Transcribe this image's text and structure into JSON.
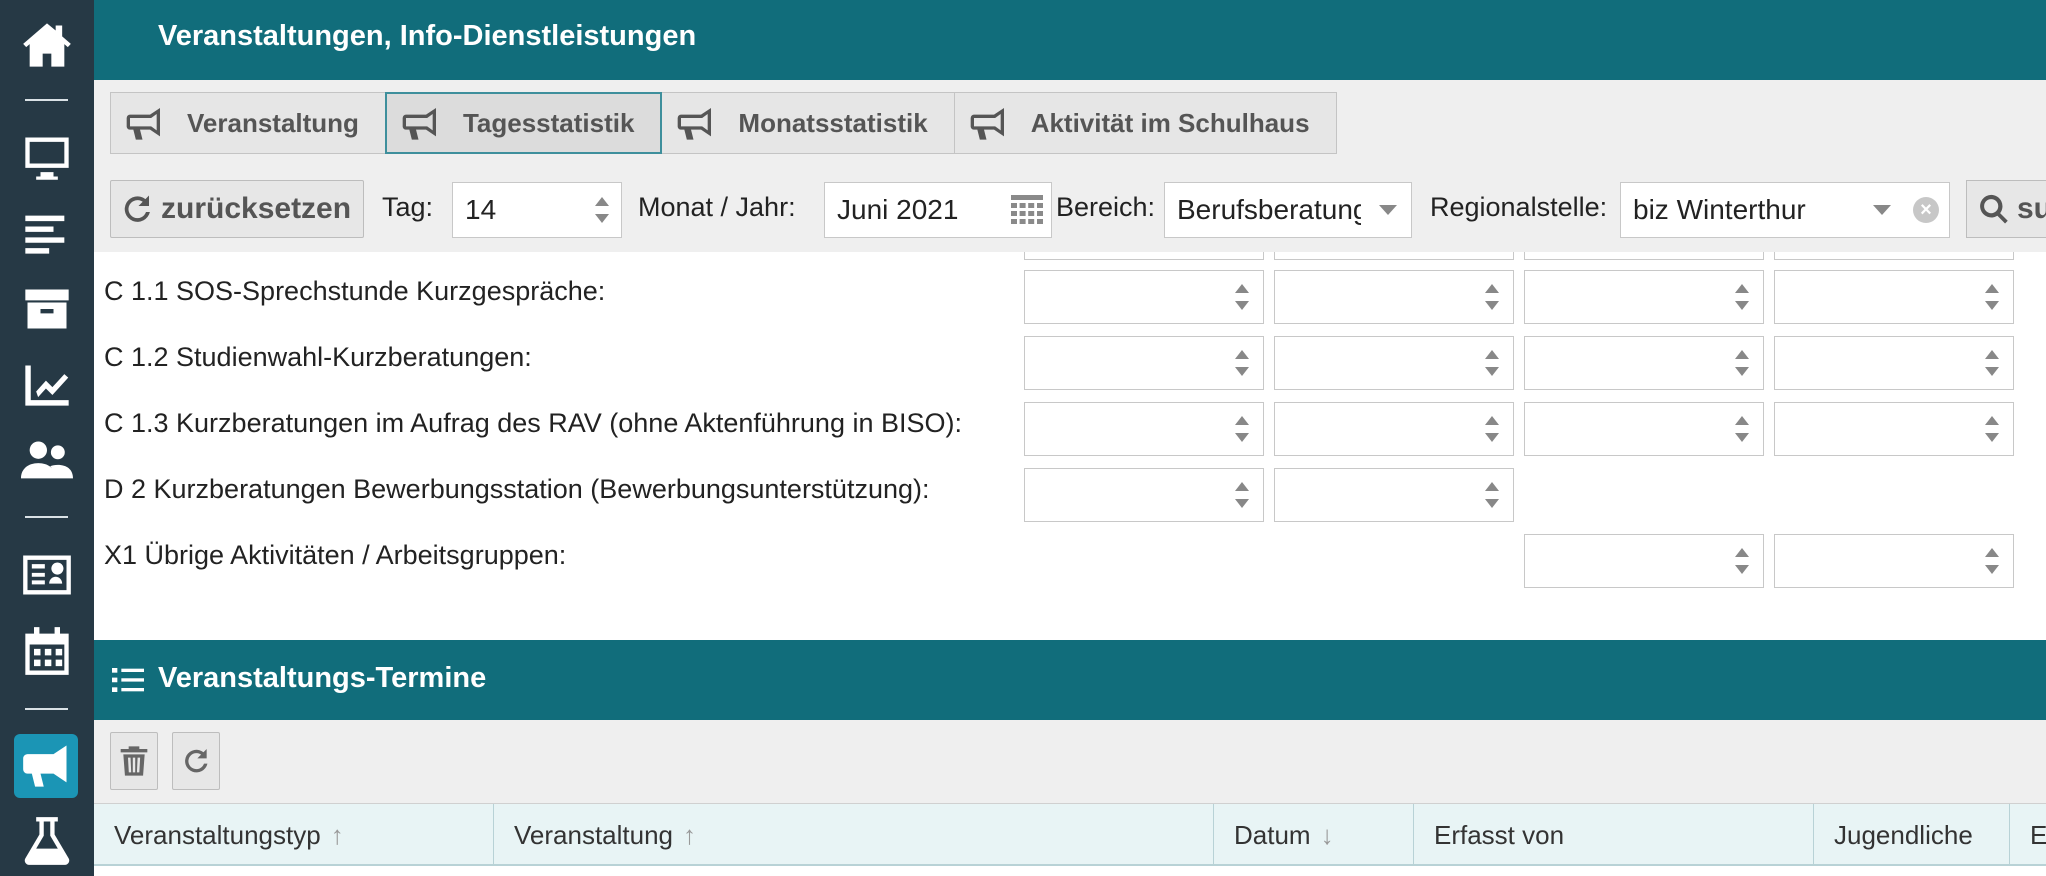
{
  "app": {
    "title": "Veranstaltungen, Info-Dienstleistungen"
  },
  "sidebar": {
    "items": [
      {
        "icon": "home-icon"
      },
      {
        "icon": "desktop-icon"
      },
      {
        "icon": "align-left-icon"
      },
      {
        "icon": "archive-icon"
      },
      {
        "icon": "chart-line-icon"
      },
      {
        "icon": "users-icon"
      },
      {
        "icon": "id-card-icon"
      },
      {
        "icon": "calendar-icon"
      },
      {
        "icon": "megaphone-icon",
        "active": true
      },
      {
        "icon": "flask-icon"
      }
    ],
    "active_color": "#1b95b5"
  },
  "tabs": [
    {
      "label": "Veranstaltung",
      "icon": "megaphone-icon"
    },
    {
      "label": "Tagesstatistik",
      "icon": "megaphone-icon",
      "active": true
    },
    {
      "label": "Monatsstatistik",
      "icon": "megaphone-icon"
    },
    {
      "label": "Aktivität im Schulhaus",
      "icon": "megaphone-icon"
    }
  ],
  "filters": {
    "reset_label": "zurücksetzen",
    "day_label": "Tag:",
    "day_value": "14",
    "month_label": "Monat / Jahr:",
    "month_value": "Juni 2021",
    "area_label": "Bereich:",
    "area_value": "Berufsberatung",
    "region_label": "Regionalstelle:",
    "region_value": "biz Winterthur",
    "search_label": "suchen"
  },
  "form_rows": [
    {
      "label": "C 1.1 SOS-Sprechstunde Kurzgespräche:"
    },
    {
      "label": "C 1.2 Studienwahl-Kurzberatungen:"
    },
    {
      "label": "C 1.3 Kurzberatungen im Aufrag des RAV (ohne Aktenführung in BISO):"
    },
    {
      "label": "D 2 Kurzberatungen Bewerbungsstation (Bewerbungsunterstützung):"
    },
    {
      "label": "X1 Übrige Aktivitäten / Arbeitsgruppen:"
    }
  ],
  "section": {
    "title": "Veranstaltungs-Termine"
  },
  "table": {
    "columns": [
      {
        "label": "Veranstaltungstyp",
        "sort": "↑"
      },
      {
        "label": "Veranstaltung",
        "sort": "↑"
      },
      {
        "label": "Datum",
        "sort": "↓"
      },
      {
        "label": "Erfasst von",
        "sort": ""
      },
      {
        "label": "Jugendliche",
        "sort": ""
      },
      {
        "label": "E",
        "sort": ""
      }
    ]
  },
  "colors": {
    "header_bg": "#116d7b",
    "sidebar_bg": "#263945",
    "toolbar_bg": "#efefef"
  }
}
